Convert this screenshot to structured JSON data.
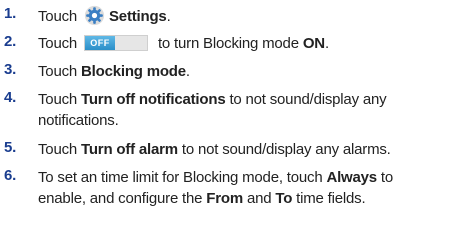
{
  "steps": [
    {
      "num": "1.",
      "parts": [
        "Touch",
        "Settings",
        "."
      ]
    },
    {
      "num": "2.",
      "parts": [
        "Touch",
        "OFF",
        "to turn Blocking mode",
        "ON",
        "."
      ]
    },
    {
      "num": "3.",
      "parts": [
        "Touch",
        "Blocking mode",
        "."
      ]
    },
    {
      "num": "4.",
      "parts": [
        "Touch",
        "Turn off notifications",
        "to not sound/display any",
        "notifications."
      ]
    },
    {
      "num": "5.",
      "parts": [
        "Touch",
        "Turn off alarm",
        "to not sound/display any alarms."
      ]
    },
    {
      "num": "6.",
      "parts": [
        "To set an time limit for Blocking mode, touch",
        "Always",
        "to",
        "enable, and configure the",
        "From",
        "and",
        "To",
        "time fields."
      ]
    }
  ],
  "colors": {
    "number": "#1a3d8f",
    "toggle": "#2b8fc8"
  },
  "icons": {
    "settings": "gear-icon",
    "toggle": "toggle-switch-icon"
  }
}
